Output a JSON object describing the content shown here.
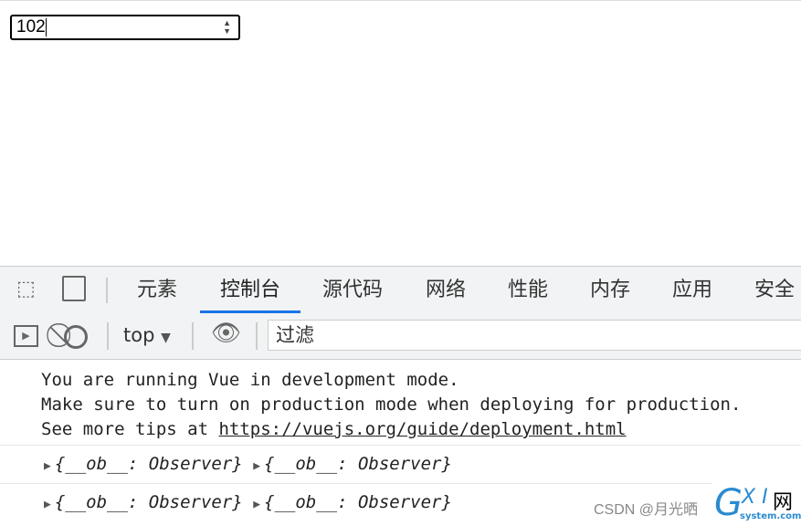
{
  "number_input": {
    "value": "102"
  },
  "devtools": {
    "tabs": [
      "元素",
      "控制台",
      "源代码",
      "网络",
      "性能",
      "内存",
      "应用",
      "安全"
    ],
    "active_tab": "控制台",
    "toolbar": {
      "context": "top",
      "filter_placeholder": "过滤"
    }
  },
  "console": {
    "lines": [
      "You are running Vue in development mode.",
      "Make sure to turn on production mode when deploying for production."
    ],
    "tips_prefix": "See more tips at ",
    "tips_link": "https://vuejs.org/guide/deployment.html",
    "objects": [
      [
        "{__ob__: Observer}",
        "{__ob__: Observer}"
      ],
      [
        "{__ob__: Observer}",
        "{__ob__: Observer}"
      ]
    ]
  },
  "watermark": {
    "text": "CSDN @月光晒",
    "logo": "GXI网 system.com"
  },
  "colors": {
    "accent": "#1a73e8"
  }
}
